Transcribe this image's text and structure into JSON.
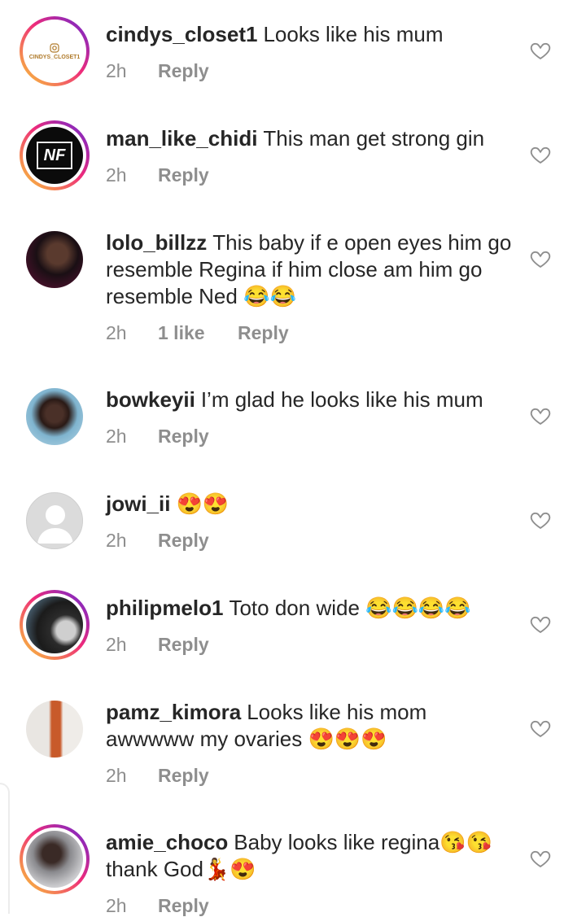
{
  "comments": [
    {
      "username": "cindys_closet1",
      "text": "Looks like his mum",
      "time": "2h",
      "likes": "",
      "reply": "Reply",
      "avatar": "cindys-closet-logo",
      "avatar_text": "CINDYS_CLOSET1"
    },
    {
      "username": "man_like_chidi",
      "text": "This man get strong gin",
      "time": "2h",
      "likes": "",
      "reply": "Reply",
      "avatar": "nf-logo",
      "avatar_text": "NF"
    },
    {
      "username": "lolo_billzz",
      "text": "This baby if e open eyes him go resemble Regina if him close am him go resemble Ned 😂😂",
      "time": "2h",
      "likes": "1 like",
      "reply": "Reply",
      "avatar": "user-photo"
    },
    {
      "username": "bowkeyii",
      "text": "I’m glad he looks like his mum",
      "time": "2h",
      "likes": "",
      "reply": "Reply",
      "avatar": "user-photo"
    },
    {
      "username": "jowi_ii",
      "text": "😍😍",
      "time": "2h",
      "likes": "",
      "reply": "Reply",
      "avatar": "default-avatar"
    },
    {
      "username": "philipmelo1",
      "text": "Toto don wide 😂😂😂😂",
      "time": "2h",
      "likes": "",
      "reply": "Reply",
      "avatar": "user-photo"
    },
    {
      "username": "pamz_kimora",
      "text": "Looks like his mom awwwww my ovaries 😍😍😍",
      "time": "2h",
      "likes": "",
      "reply": "Reply",
      "avatar": "user-photo"
    },
    {
      "username": "amie_choco",
      "text": "Baby looks like regina😘😘thank God💃😍",
      "time": "2h",
      "likes": "",
      "reply": "Reply",
      "avatar": "user-photo"
    }
  ],
  "colors": {
    "text": "#262626",
    "meta": "#8e8e8e",
    "heart": "#8e8e8e",
    "ring_start": "#f9ce34",
    "ring_mid": "#ee2a7b",
    "ring_end": "#6228d7"
  },
  "icons": {
    "like": "heart-outline-icon"
  }
}
